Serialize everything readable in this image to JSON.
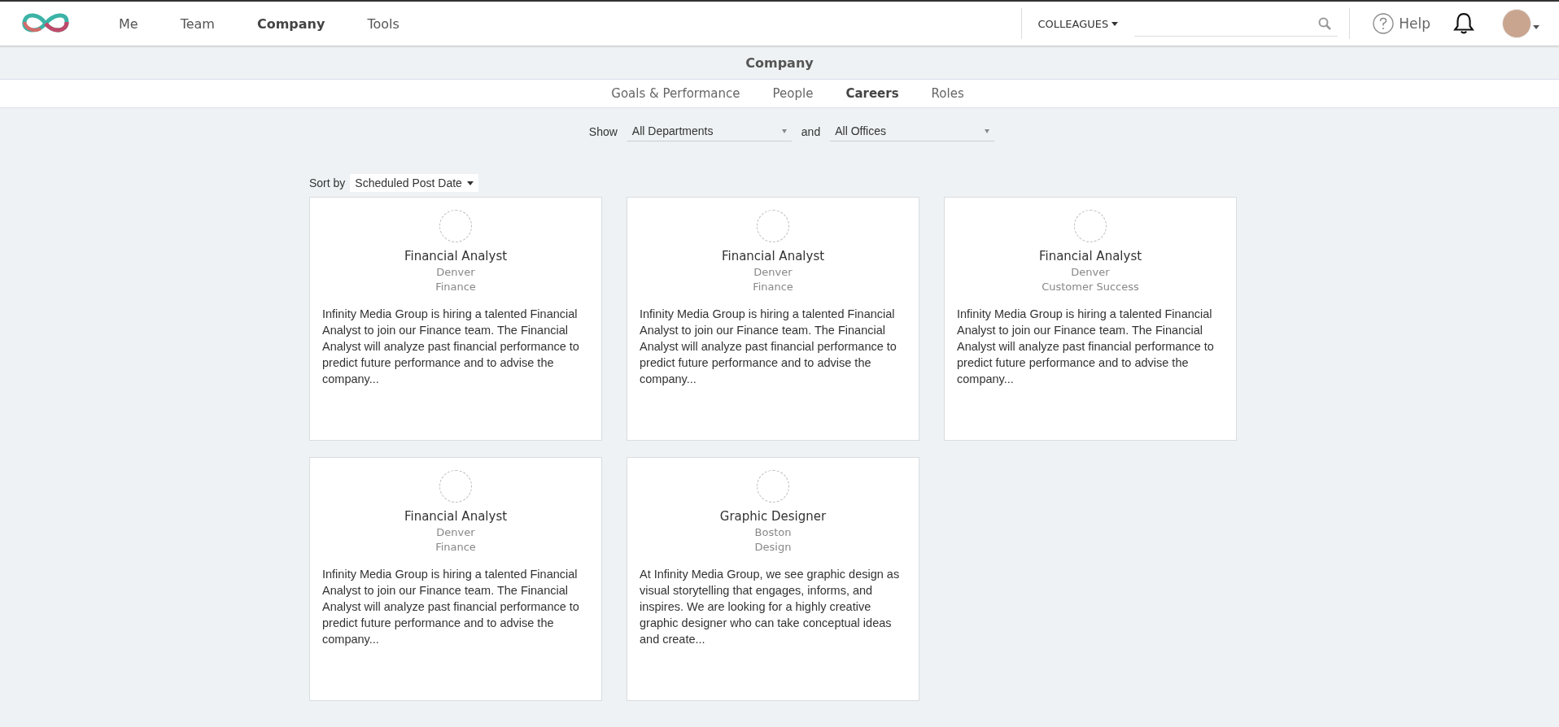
{
  "nav": {
    "items": [
      {
        "label": "Me",
        "selected": false
      },
      {
        "label": "Team",
        "selected": false
      },
      {
        "label": "Company",
        "selected": true
      },
      {
        "label": "Tools",
        "selected": false
      }
    ],
    "search_scope": "COLLEAGUES",
    "help": "Help"
  },
  "page_title": "Company",
  "tabs": [
    {
      "label": "Goals & Performance",
      "selected": false
    },
    {
      "label": "People",
      "selected": false
    },
    {
      "label": "Careers",
      "selected": true
    },
    {
      "label": "Roles",
      "selected": false
    }
  ],
  "filters": {
    "show_label": "Show",
    "department": "All Departments",
    "joiner": "and",
    "office": "All Offices"
  },
  "sort": {
    "label": "Sort by",
    "value": "Scheduled Post Date"
  },
  "jobs": [
    {
      "title": "Financial Analyst",
      "location": "Denver",
      "department": "Finance",
      "description": "Infinity Media Group is hiring a talented Financial Analyst to join our Finance team. The Financial Analyst will analyze past financial performance to predict future performance and to advise the company..."
    },
    {
      "title": "Financial Analyst",
      "location": "Denver",
      "department": "Finance",
      "description": "Infinity Media Group is hiring a talented Financial Analyst to join our Finance team. The Financial Analyst will analyze past financial performance to predict future performance and to advise the company..."
    },
    {
      "title": "Financial Analyst",
      "location": "Denver",
      "department": "Customer Success",
      "description": "Infinity Media Group is hiring a talented Financial Analyst to join our Finance team. The Financial Analyst will analyze past financial performance to predict future performance and to advise the company..."
    },
    {
      "title": "Financial Analyst",
      "location": "Denver",
      "department": "Finance",
      "description": "Infinity Media Group is hiring a talented Financial Analyst to join our Finance team. The Financial Analyst will analyze past financial performance to predict future performance and to advise the company..."
    },
    {
      "title": "Graphic Designer",
      "location": "Boston",
      "department": "Design",
      "description": "At Infinity Media Group, we see graphic design as visual storytelling that engages, informs, and inspires. We are looking for a highly creative graphic designer who can take conceptual ideas and create..."
    }
  ]
}
